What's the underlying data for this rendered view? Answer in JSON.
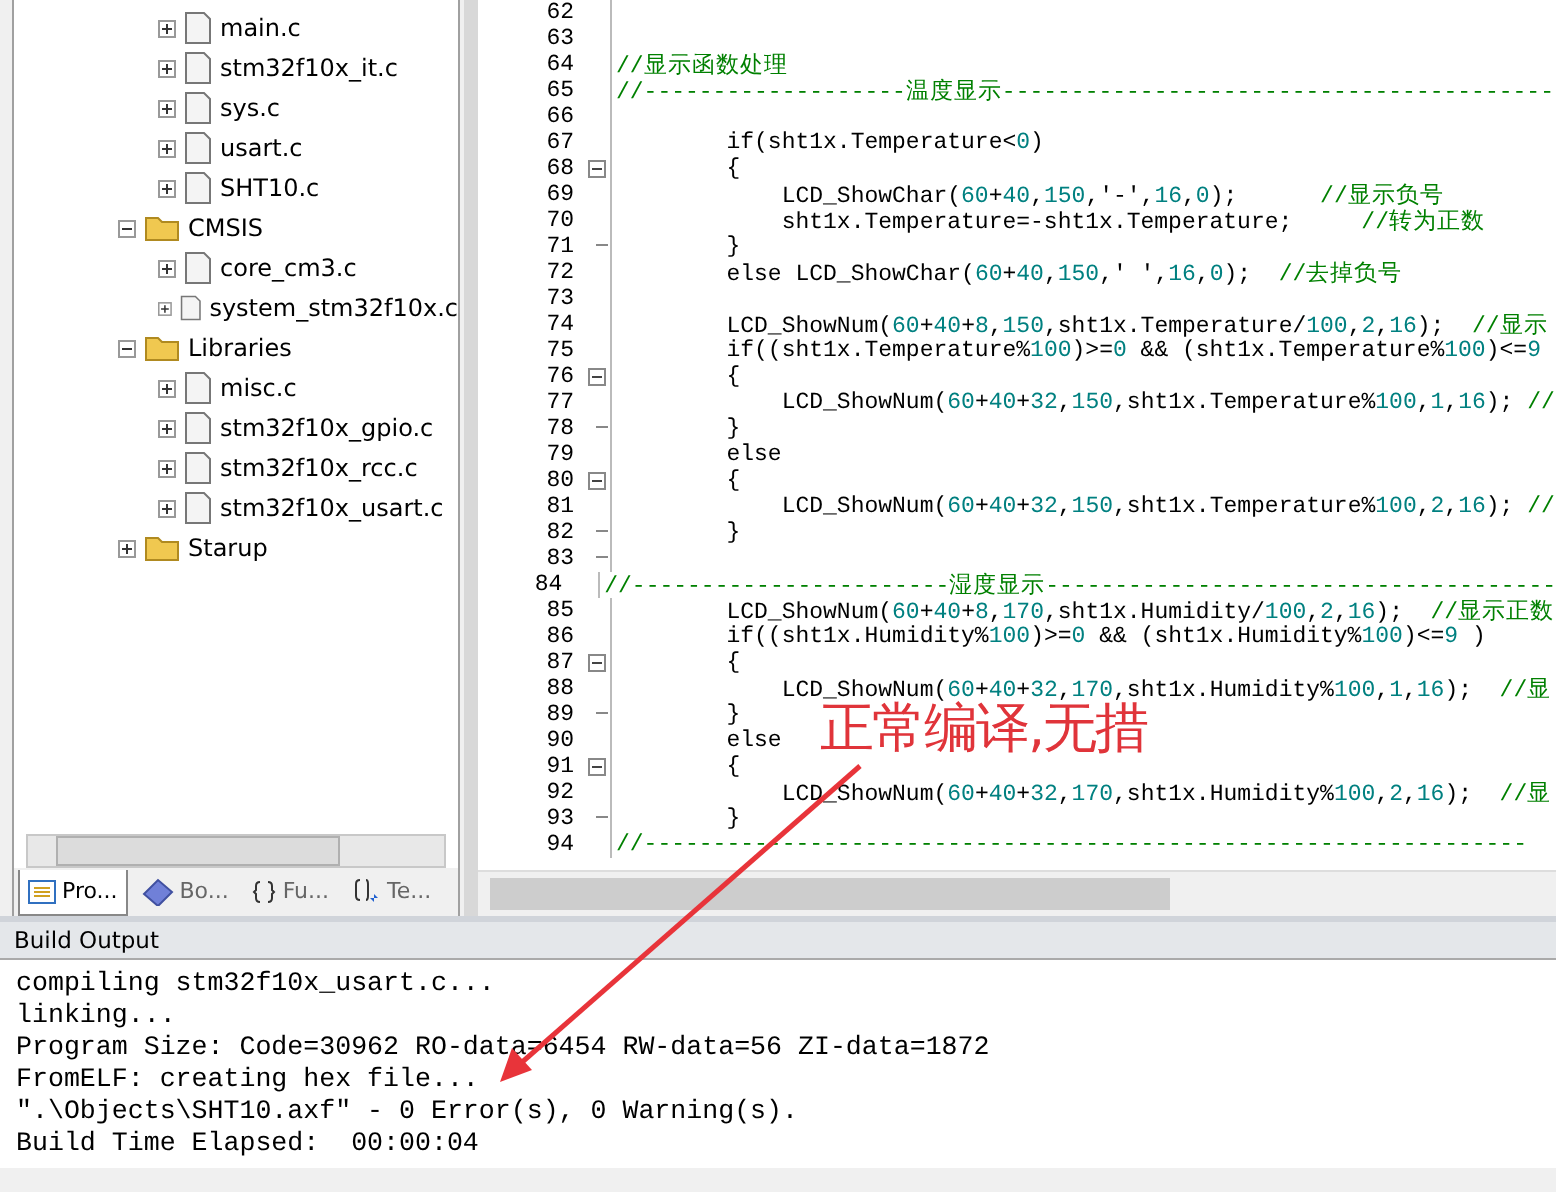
{
  "project_tree": [
    {
      "label": "main.c",
      "kind": "file"
    },
    {
      "label": "stm32f10x_it.c",
      "kind": "file"
    },
    {
      "label": "sys.c",
      "kind": "file"
    },
    {
      "label": "usart.c",
      "kind": "file"
    },
    {
      "label": "SHT10.c",
      "kind": "file"
    },
    {
      "label": "CMSIS",
      "kind": "group",
      "expanded": true,
      "children": [
        {
          "label": "core_cm3.c",
          "kind": "file"
        },
        {
          "label": "system_stm32f10x.c",
          "kind": "file"
        }
      ]
    },
    {
      "label": "Libraries",
      "kind": "group",
      "expanded": true,
      "children": [
        {
          "label": "misc.c",
          "kind": "file"
        },
        {
          "label": "stm32f10x_gpio.c",
          "kind": "file"
        },
        {
          "label": "stm32f10x_rcc.c",
          "kind": "file"
        },
        {
          "label": "stm32f10x_usart.c",
          "kind": "file"
        }
      ]
    },
    {
      "label": "Starup",
      "kind": "group",
      "expanded": false
    }
  ],
  "panel_tabs": [
    {
      "label": "Pro...",
      "kind": "project",
      "selected": true
    },
    {
      "label": "Bo...",
      "kind": "books",
      "selected": false
    },
    {
      "label": "Fu...",
      "kind": "functions",
      "selected": false
    },
    {
      "label": "Te...",
      "kind": "templates",
      "selected": false
    }
  ],
  "editor_lines": [
    {
      "number": "62",
      "kind": "plain"
    },
    {
      "number": "63",
      "kind": "plain"
    },
    {
      "number": "64",
      "kind": "plain",
      "code": "//显示函数处理"
    },
    {
      "number": "65",
      "kind": "plain",
      "code": "//-------------------温度显示----------------------------------------"
    },
    {
      "number": "66",
      "kind": "plain"
    },
    {
      "number": "67",
      "kind": "plain",
      "code": "        if(sht1x.Temperature<0)"
    },
    {
      "number": "68",
      "kind": "fold_start",
      "code": "        {"
    },
    {
      "number": "69",
      "kind": "plain",
      "code": "            LCD_ShowChar(60+40,150,'-',16,0);      //显示负号"
    },
    {
      "number": "70",
      "kind": "plain",
      "code": "            sht1x.Temperature=-sht1x.Temperature;     //转为正数"
    },
    {
      "number": "71",
      "kind": "fold_end",
      "code": "        }"
    },
    {
      "number": "72",
      "kind": "plain",
      "code": "        else LCD_ShowChar(60+40,150,' ',16,0);  //去掉负号"
    },
    {
      "number": "73",
      "kind": "plain"
    },
    {
      "number": "74",
      "kind": "plain",
      "code": "        LCD_ShowNum(60+40+8,150,sht1x.Temperature/100,2,16);  //显示"
    },
    {
      "number": "75",
      "kind": "plain",
      "code": "        if((sht1x.Temperature%100)>=0 && (sht1x.Temperature%100)<=9"
    },
    {
      "number": "76",
      "kind": "fold_start",
      "code": "        {"
    },
    {
      "number": "77",
      "kind": "plain",
      "code": "            LCD_ShowNum(60+40+32,150,sht1x.Temperature%100,1,16); //"
    },
    {
      "number": "78",
      "kind": "fold_end",
      "code": "        }"
    },
    {
      "number": "79",
      "kind": "plain",
      "code": "        else"
    },
    {
      "number": "80",
      "kind": "fold_start",
      "code": "        {"
    },
    {
      "number": "81",
      "kind": "plain",
      "code": "            LCD_ShowNum(60+40+32,150,sht1x.Temperature%100,2,16); //"
    },
    {
      "number": "82",
      "kind": "fold_end",
      "code": "        }"
    },
    {
      "number": "83",
      "kind": "fold_end"
    },
    {
      "number": "84",
      "kind": "plain",
      "code": "//-----------------------湿度显示-------------------------------------"
    },
    {
      "number": "85",
      "kind": "plain",
      "code": "        LCD_ShowNum(60+40+8,170,sht1x.Humidity/100,2,16);  //显示正数"
    },
    {
      "number": "86",
      "kind": "plain",
      "code": "        if((sht1x.Humidity%100)>=0 && (sht1x.Humidity%100)<=9 )"
    },
    {
      "number": "87",
      "kind": "fold_start",
      "code": "        {"
    },
    {
      "number": "88",
      "kind": "plain",
      "code": "            LCD_ShowNum(60+40+32,170,sht1x.Humidity%100,1,16);  //显"
    },
    {
      "number": "89",
      "kind": "fold_end",
      "code": "        }"
    },
    {
      "number": "90",
      "kind": "plain",
      "code": "        else"
    },
    {
      "number": "91",
      "kind": "fold_start",
      "code": "        {"
    },
    {
      "number": "92",
      "kind": "plain",
      "code": "            LCD_ShowNum(60+40+32,170,sht1x.Humidity%100,2,16);  //显"
    },
    {
      "number": "93",
      "kind": "fold_end",
      "code": "        }"
    },
    {
      "number": "94",
      "kind": "plain",
      "code": "//----------------------------------------------------------------"
    }
  ],
  "annotation": {
    "text": "正常编译,无措"
  },
  "build_output": {
    "title": "Build Output",
    "lines": [
      "compiling stm32f10x_usart.c...",
      "linking...",
      "Program Size: Code=30962 RO-data=6454 RW-data=56 ZI-data=1872",
      "FromELF: creating hex file...",
      "\".\\Objects\\SHT10.axf\" - 0 Error(s), 0 Warning(s).",
      "Build Time Elapsed:  00:00:04"
    ]
  }
}
